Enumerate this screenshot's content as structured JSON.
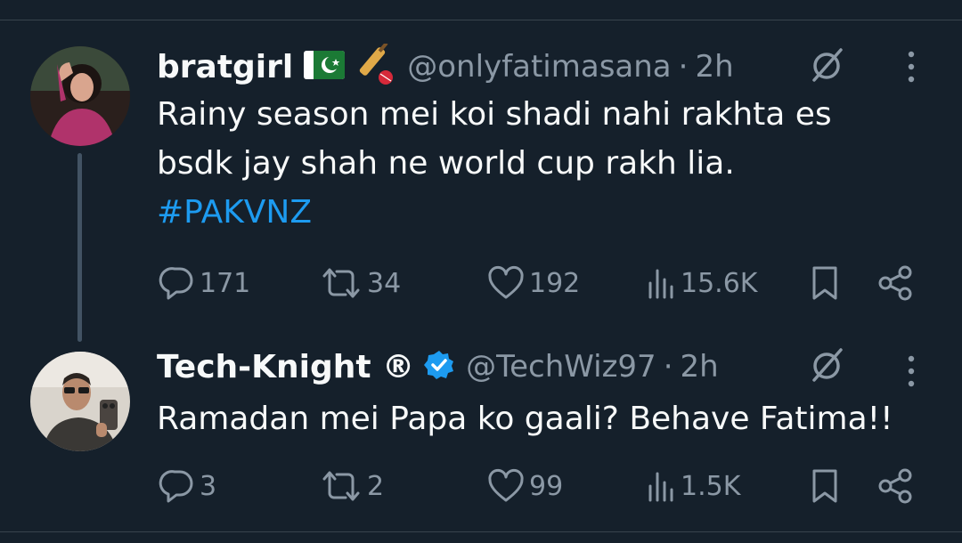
{
  "tweets": [
    {
      "display_name": "bratgirl",
      "emoji_flag": "pakistan-flag",
      "emoji_cricket": "cricket-bat",
      "handle": "@onlyfatimasana",
      "dot": "·",
      "time": "2h",
      "text_lines": [
        "Rainy season mei koi shadi nahi rakhta es",
        "bsdk jay shah ne world cup rakh lia."
      ],
      "hashtag": "#PAKVNZ",
      "stats": {
        "replies": "171",
        "retweets": "34",
        "likes": "192",
        "views": "15.6K"
      }
    },
    {
      "display_name": "Tech-Knight ®",
      "verified": true,
      "handle": "@TechWiz97",
      "dot": "·",
      "time": "2h",
      "text_lines": [
        "Ramadan mei Papa ko gaali? Behave Fatima!!"
      ],
      "stats": {
        "replies": "3",
        "retweets": "2",
        "likes": "99",
        "views": "1.5K"
      }
    }
  ],
  "icons": [
    "reply-icon",
    "retweet-icon",
    "like-icon",
    "views-icon",
    "bookmark-icon",
    "share-icon",
    "grok-icon",
    "more-icon",
    "verified-badge-icon"
  ],
  "colors": {
    "background": "#15202b",
    "text": "#f7f9f9",
    "muted": "#8b98a5",
    "accent": "#1d9bf0",
    "divider": "#38444d"
  }
}
